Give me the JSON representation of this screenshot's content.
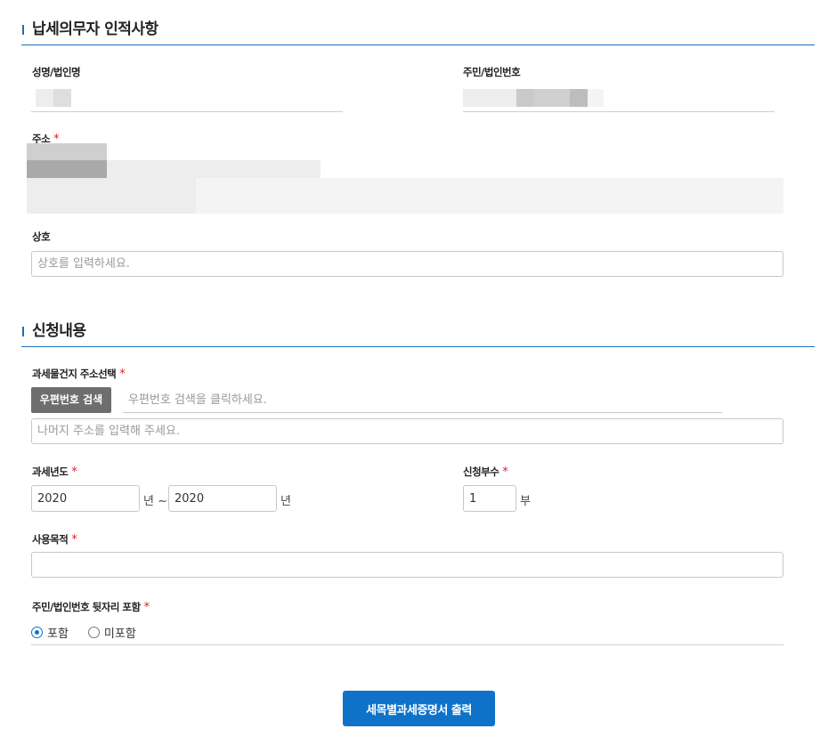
{
  "taxpayer": {
    "title": "납세의무자 인적사항",
    "name_label": "성명/법인명",
    "id_label": "주민/법인번호",
    "address_label": "주소",
    "trade_name_label": "상호",
    "trade_name_placeholder": "상호를 입력하세요."
  },
  "request": {
    "title": "신청내용",
    "property_address_label": "과세물건지 주소선택",
    "zip_search_button": "우편번호 검색",
    "zip_placeholder": "우편번호 검색을 클릭하세요.",
    "rest_address_placeholder": "나머지 주소를 입력해 주세요.",
    "tax_year_label": "과세년도",
    "year_from": "2020",
    "year_to": "2020",
    "year_unit_sep": "년 ~",
    "year_unit": "년",
    "copies_label": "신청부수",
    "copies_value": "1",
    "copies_unit": "부",
    "purpose_label": "사용목적",
    "purpose_value": "",
    "include_back_digits_label": "주민/법인번호 뒷자리 포함",
    "include_options": [
      {
        "label": "포함",
        "selected": true
      },
      {
        "label": "미포함",
        "selected": false
      }
    ]
  },
  "required_mark": "*",
  "print_button": "세목별과세증명서 출력",
  "colors": {
    "accent": "#0e72c9",
    "section_line": "#1a6fbf",
    "required": "#d9232d",
    "gray_button": "#6e6e6e"
  }
}
